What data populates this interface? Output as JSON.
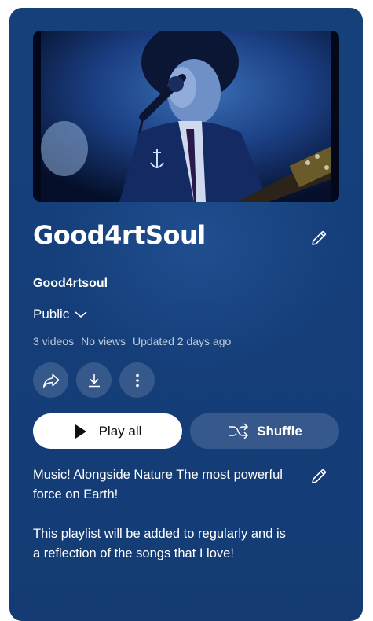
{
  "playlist": {
    "title": "Good4rtSoul",
    "owner": "Good4rtsoul",
    "privacy": "Public",
    "video_count": "3 videos",
    "views": "No views",
    "updated": "Updated 2 days ago",
    "description_lines": [
      "Music! Alongside Nature The most powerful force on Earth!",
      "This playlist will be added to regularly and is a reflection of the songs that I love!"
    ]
  },
  "actions": {
    "play_all_label": "Play all",
    "shuffle_label": "Shuffle"
  },
  "icons": {
    "edit_title": "pencil-icon",
    "edit_description": "pencil-icon",
    "privacy_dropdown": "chevron-down-icon",
    "share": "share-icon",
    "download": "download-icon",
    "more": "more-vertical-icon",
    "play": "play-icon",
    "shuffle": "shuffle-icon"
  },
  "colors": {
    "card_background": "#153f7a",
    "button_primary": "#ffffff",
    "button_secondary": "rgba(255,255,255,0.14)"
  }
}
